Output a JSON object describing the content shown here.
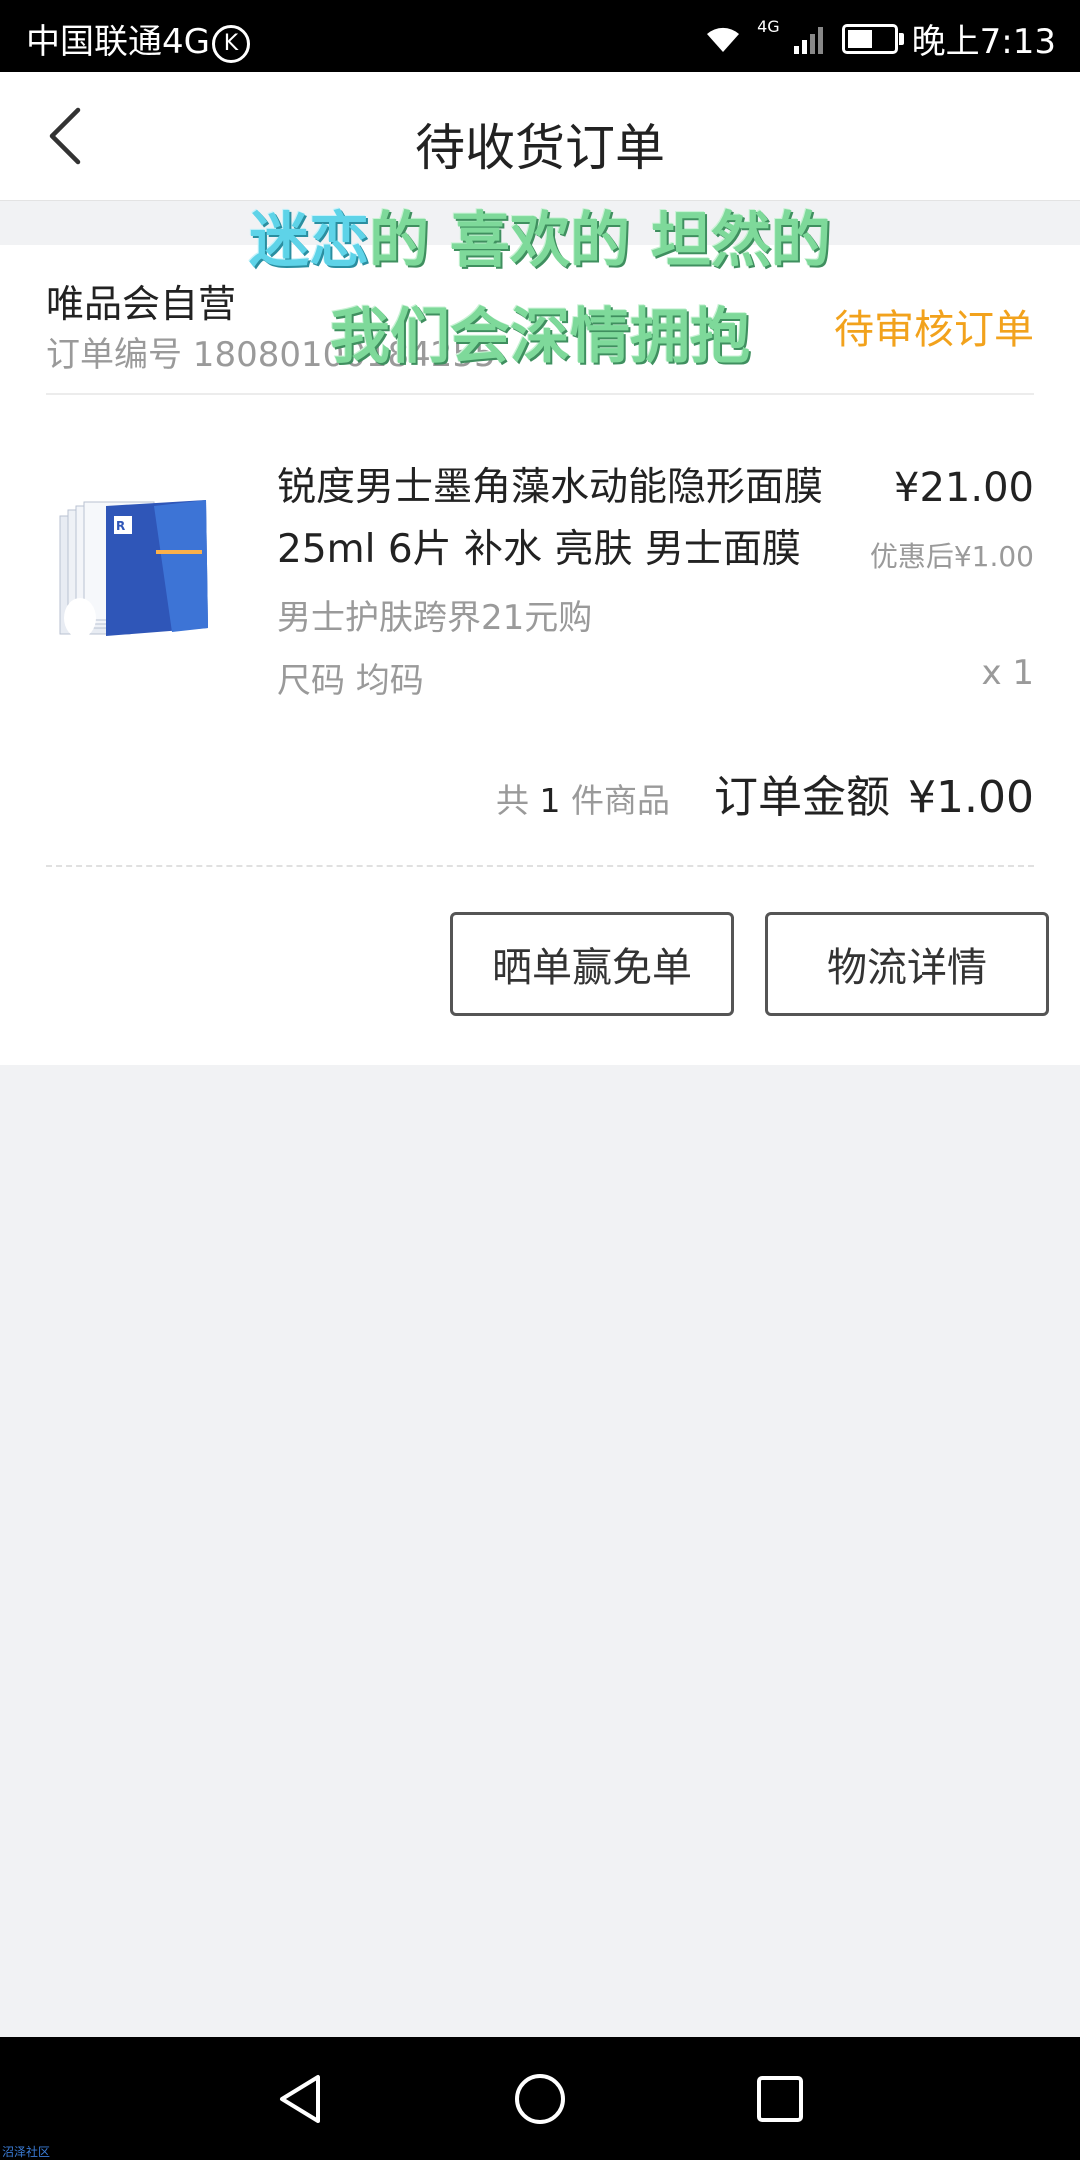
{
  "status_bar": {
    "carrier": "中国联通4G",
    "carrier_badge": "K",
    "network": "4G",
    "time": "晚上7:13",
    "battery_level": 0.55
  },
  "header": {
    "title": "待收货订单",
    "back_icon": "chevron-left-icon"
  },
  "order": {
    "shop_name": "唯品会自营",
    "order_number": "订单编号 18080100184255",
    "status": "待审核订单",
    "status_color": "#f2a21c",
    "product": {
      "name": "锐度男士墨角藻水动能隐形面膜 25ml 6片 补水 亮肤 男士面膜",
      "price": "¥21.00",
      "discount": "优惠后¥1.00",
      "promo": "男士护肤跨界21元购",
      "size": "尺码 均码",
      "quantity": "x 1"
    },
    "summary": {
      "count_prefix": "共",
      "count": "1",
      "count_suffix": "件商品",
      "total_label": "订单金额",
      "total_value": "¥1.00"
    },
    "buttons": {
      "share": "晒单赢免单",
      "logistics": "物流详情"
    }
  },
  "overlay_text": {
    "line1_part1": "迷恋",
    "line1_part2": "的 喜欢的 坦然的",
    "line2": "我们会深情拥抱"
  },
  "nav_bar": {
    "icons": [
      "back-triangle-icon",
      "home-circle-icon",
      "recents-square-icon"
    ]
  },
  "watermark": "沼泽社区"
}
